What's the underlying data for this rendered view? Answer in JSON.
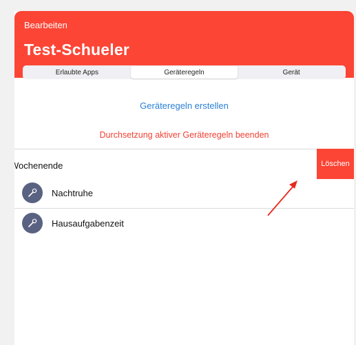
{
  "header": {
    "back_label": "Bearbeiten",
    "title": "Test-Schueler",
    "color": "#fc4535"
  },
  "tabs": [
    {
      "label": "Erlaubte Apps",
      "active": false
    },
    {
      "label": "Geräteregeln",
      "active": true
    },
    {
      "label": "Gerät",
      "active": false
    }
  ],
  "actions": {
    "create_label": "Geräteregeln erstellen",
    "stop_label": "Durchsetzung aktiver Geräteregeln beenden"
  },
  "group": {
    "title": "Wochenende",
    "delete_label": "Löschen"
  },
  "rules": [
    {
      "label": "Nachtruhe",
      "icon": "wrench-icon"
    },
    {
      "label": "Hausaufgabenzeit",
      "icon": "wrench-icon"
    }
  ]
}
